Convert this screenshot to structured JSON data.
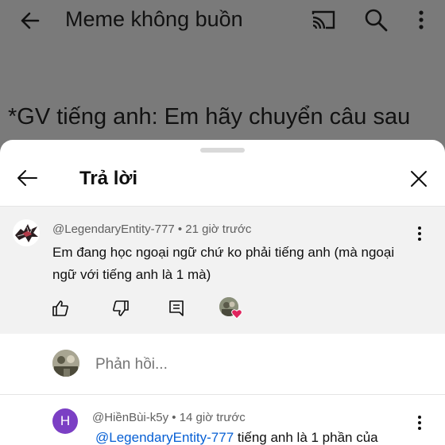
{
  "background": {
    "video_title": "Meme không buồn",
    "caption": "*GV tiếng anh: Em hãy chuyển câu sau"
  },
  "sheet": {
    "title": "Trả lời"
  },
  "comment": {
    "author": "@LegendaryEntity-777",
    "time": "21 giờ trước",
    "text": "Em đang học ngoại ngữ chứ ko phải tiếng anh (mà ngoại ngữ với tiếng anh là 1 mà)"
  },
  "reply_input": {
    "placeholder": "Phản hồi..."
  },
  "reply": {
    "avatar_letter": "H",
    "author": "@HiềnBùi-k5y",
    "time": "14 giờ trước",
    "mention": "@LegendaryEntity-777",
    "text": " tiếng anh là 1 phần của"
  },
  "colors": {
    "accent_link": "#065fd4",
    "avatar_purple": "#7b3fc4",
    "heart": "#e0245e"
  }
}
